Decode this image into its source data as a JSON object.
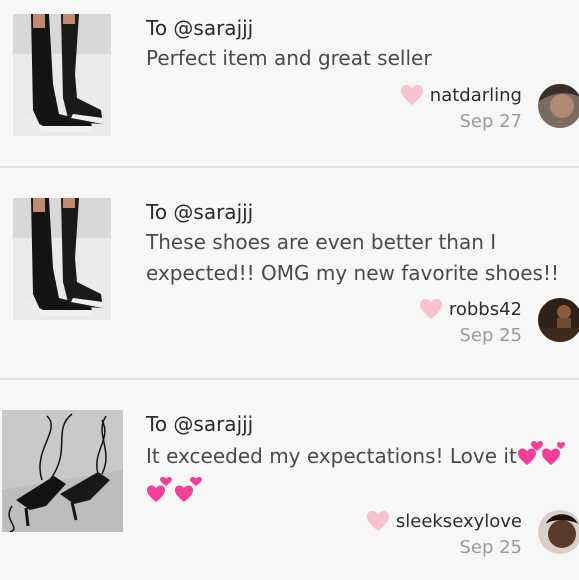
{
  "reviews": [
    {
      "to": "To @sarajjj",
      "message": "Perfect item and great seller",
      "author": "natdarling",
      "date": "Sep 27",
      "thumb_icon": "black-sock-boots-photo",
      "avatar_icon": "user-avatar"
    },
    {
      "to": "To @sarajjj",
      "message": "These shoes are even better than I expected!! OMG my new favorite shoes!!",
      "author": "robbs42",
      "date": "Sep 25",
      "thumb_icon": "black-sock-boots-photo",
      "avatar_icon": "user-avatar"
    },
    {
      "to": "To @sarajjj",
      "message": "It exceeded my expectations! Love it",
      "author": "sleeksexylove",
      "date": "Sep 25",
      "thumb_icon": "lace-up-heels-photo",
      "avatar_icon": "user-avatar",
      "emoji": "revolving-hearts-emoji"
    }
  ],
  "colors": {
    "heart": "#f8c2cf",
    "emoji_pink": "#f0409a",
    "divider": "#e2e2e2"
  }
}
